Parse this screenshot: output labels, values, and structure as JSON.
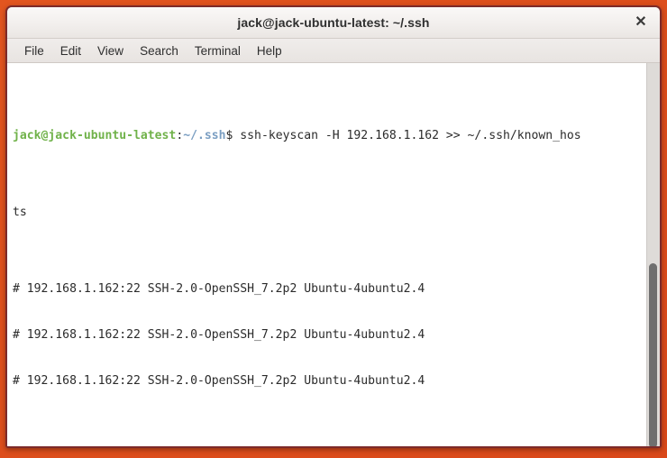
{
  "window": {
    "title": "jack@jack-ubuntu-latest: ~/.ssh",
    "close_icon": "close-icon",
    "close_glyph": "✕"
  },
  "menubar": {
    "items": [
      {
        "label": "File"
      },
      {
        "label": "Edit"
      },
      {
        "label": "View"
      },
      {
        "label": "Search"
      },
      {
        "label": "Terminal"
      },
      {
        "label": "Help"
      }
    ]
  },
  "terminal": {
    "prompt": {
      "user_host": "jack@jack-ubuntu-latest",
      "separator": ":",
      "path": "~/.ssh",
      "sigil": "$"
    },
    "command": " ssh-keyscan -H 192.168.1.162 >> ~/.ssh/known_hos",
    "command_wrap": "ts",
    "output_lines": [
      "# 192.168.1.162:22 SSH-2.0-OpenSSH_7.2p2 Ubuntu-4ubuntu2.4",
      "# 192.168.1.162:22 SSH-2.0-OpenSSH_7.2p2 Ubuntu-4ubuntu2.4",
      "# 192.168.1.162:22 SSH-2.0-OpenSSH_7.2p2 Ubuntu-4ubuntu2.4"
    ],
    "colors": {
      "user_host": "#70b24a",
      "path": "#7a9ec2",
      "text": "#2b2b2b",
      "background": "#ffffff",
      "cursor": "#3b3b3b"
    }
  },
  "scrollbar": {
    "name": "vertical-scrollbar"
  },
  "desktop": {
    "accent": "#e2551f"
  }
}
